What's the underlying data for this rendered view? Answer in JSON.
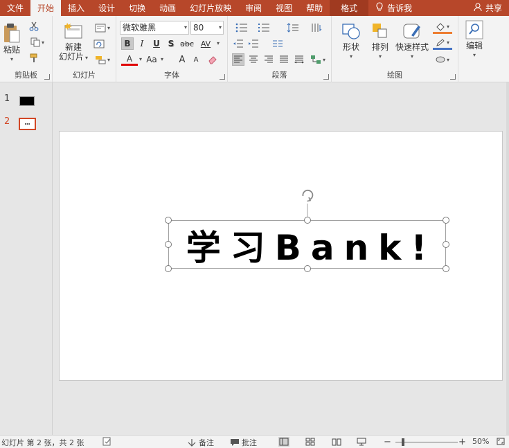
{
  "tabs": [
    {
      "name": "file",
      "label": "文件",
      "active": false
    },
    {
      "name": "home",
      "label": "开始",
      "active": true
    },
    {
      "name": "insert",
      "label": "插入",
      "active": false
    },
    {
      "name": "design",
      "label": "设计",
      "active": false
    },
    {
      "name": "transitions",
      "label": "切换",
      "active": false
    },
    {
      "name": "animations",
      "label": "动画",
      "active": false
    },
    {
      "name": "slideshow",
      "label": "幻灯片放映",
      "active": false
    },
    {
      "name": "review",
      "label": "审阅",
      "active": false
    },
    {
      "name": "view",
      "label": "视图",
      "active": false
    },
    {
      "name": "help",
      "label": "帮助",
      "active": false
    },
    {
      "name": "format",
      "label": "格式",
      "active": false
    }
  ],
  "tellme": {
    "label": "告诉我",
    "icon": "lightbulb-icon"
  },
  "share": {
    "label": "共享",
    "icon": "person-icon"
  },
  "ribbon": {
    "clipboard": {
      "label": "剪贴板",
      "paste_label": "粘贴"
    },
    "slides": {
      "label": "幻灯片",
      "new_slide_line1": "新建",
      "new_slide_line2": "幻灯片"
    },
    "font": {
      "label": "字体",
      "font_name": "微软雅黑",
      "font_size": "80",
      "bold": "B",
      "italic": "I",
      "underline": "U",
      "shadow": "S",
      "strike": "abc",
      "spacing": "AV",
      "font_color": "A",
      "change_case": "Aa",
      "grow": "A",
      "shrink": "A"
    },
    "paragraph": {
      "label": "段落"
    },
    "drawing": {
      "label": "绘图",
      "shapes_label": "形状",
      "arrange_label": "排列",
      "quick_styles_label": "快速样式"
    },
    "editing": {
      "label": "编辑"
    }
  },
  "thumbnails": [
    {
      "number": "1",
      "selected": false
    },
    {
      "number": "2",
      "selected": true
    }
  ],
  "slide": {
    "text": "学习Bank!"
  },
  "status": {
    "slide_info": "幻灯片 第 2 张，共 2 张",
    "notes_label": "备注",
    "comments_label": "批注",
    "zoom_minus": "−",
    "zoom_plus": "+",
    "zoom_level": "50%"
  },
  "colors": {
    "accent": "#b7472a",
    "selected_thumb": "#d24726",
    "font_color_bar": "#e00000",
    "fill_color_bar": "#ed7d31",
    "outline_color_bar": "#4472c4"
  }
}
